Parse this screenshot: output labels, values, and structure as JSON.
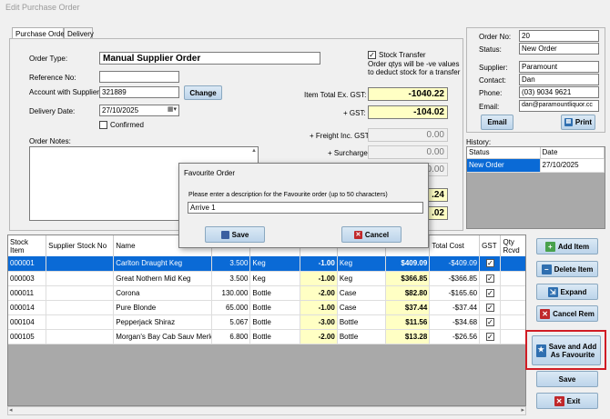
{
  "window_title": "Edit Purchase Order",
  "tabs": [
    "Purchase Order",
    "Delivery"
  ],
  "form": {
    "order_type_label": "Order Type:",
    "order_type_value": "Manual Supplier Order",
    "reference_label": "Reference No:",
    "reference_value": "",
    "account_label": "Account with Supplier:",
    "account_value": "321889",
    "change_button": "Change",
    "delivery_label": "Delivery Date:",
    "delivery_value": "27/10/2025",
    "confirmed_label": "Confirmed",
    "confirmed_checked": false,
    "notes_label": "Order Notes:",
    "stock_transfer_label": "Stock Transfer",
    "stock_transfer_checked": true,
    "stock_transfer_note_1": "Order qtys will be -ve values",
    "stock_transfer_note_2": "to deduct stock for a transfer"
  },
  "totals": {
    "item_total_label": "Item Total Ex. GST:",
    "item_total_value": "-1040.22",
    "gst_label": "+ GST:",
    "gst_value": "-104.02",
    "freight_label": "+ Freight Inc. GST",
    "freight_value": "0.00",
    "surcharge_label": "+ Surcharge",
    "surcharge_value": "0.00",
    "hidden_value_3": "0.00",
    "hidden_value_4": ".24",
    "hidden_value_5": ".02"
  },
  "order_info": {
    "order_no_label": "Order No:",
    "order_no_value": "20",
    "status_label": "Status:",
    "status_value": "New Order",
    "supplier_label": "Supplier:",
    "supplier_value": "Paramount",
    "contact_label": "Contact:",
    "contact_value": "Dan",
    "phone_label": "Phone:",
    "phone_value": "(03) 9034 9621",
    "email_label": "Email:",
    "email_value": "dan@paramountliquor.cc",
    "email_button": "Email",
    "print_button": "Print"
  },
  "history": {
    "label": "History:",
    "columns": [
      "Status",
      "Date"
    ],
    "rows": [
      [
        "New Order",
        "27/10/2025"
      ]
    ]
  },
  "grid": {
    "columns": [
      "Stock Item",
      "Supplier Stock No",
      "Name",
      "",
      "",
      "",
      "",
      "",
      "Total Cost",
      "GST",
      "Qty Rcvd"
    ],
    "rows": [
      {
        "item": "000001",
        "supplier_no": "",
        "name": "Carlton Draught Keg",
        "size": "3.500",
        "unit": "Keg",
        "qty": "-1.00",
        "order_unit": "Keg",
        "cost": "$409.09",
        "total": "-$409.09",
        "gst": true,
        "selected": true
      },
      {
        "item": "000003",
        "supplier_no": "",
        "name": "Great Nothern Mid Keg",
        "size": "3.500",
        "unit": "Keg",
        "qty": "-1.00",
        "order_unit": "Keg",
        "cost": "$366.85",
        "total": "-$366.85",
        "gst": true,
        "selected": false
      },
      {
        "item": "000011",
        "supplier_no": "",
        "name": "Corona",
        "size": "130.000",
        "unit": "Bottle",
        "qty": "-2.00",
        "order_unit": "Case",
        "cost": "$82.80",
        "total": "-$165.60",
        "gst": true,
        "selected": false
      },
      {
        "item": "000014",
        "supplier_no": "",
        "name": "Pure Blonde",
        "size": "65.000",
        "unit": "Bottle",
        "qty": "-1.00",
        "order_unit": "Case",
        "cost": "$37.44",
        "total": "-$37.44",
        "gst": true,
        "selected": false
      },
      {
        "item": "000104",
        "supplier_no": "",
        "name": "Pepperjack Shiraz",
        "size": "5.067",
        "unit": "Bottle",
        "qty": "-3.00",
        "order_unit": "Bottle",
        "cost": "$11.56",
        "total": "-$34.68",
        "gst": true,
        "selected": false
      },
      {
        "item": "000105",
        "supplier_no": "",
        "name": "Morgan's Bay Cab Sauv Merlot",
        "size": "6.800",
        "unit": "Bottle",
        "qty": "-2.00",
        "order_unit": "Bottle",
        "cost": "$13.28",
        "total": "-$26.56",
        "gst": true,
        "selected": false
      }
    ]
  },
  "side_buttons": {
    "add_item": "Add Item",
    "delete_item": "Delete Item",
    "expand": "Expand",
    "cancel_rem": "Cancel Rem",
    "save_fav_1": "Save and Add",
    "save_fav_2": "As Favourite",
    "save": "Save",
    "exit": "Exit"
  },
  "dialog": {
    "title": "Favourite Order",
    "prompt": "Please enter a description for the Favourite order (up to 50 characters)",
    "input_value": "Arrive 1",
    "save_button": "Save",
    "cancel_button": "Cancel"
  },
  "colors": {
    "highlight": "#0a6ad6",
    "yellow_field": "#ffffc4",
    "callout": "#d01c24"
  }
}
